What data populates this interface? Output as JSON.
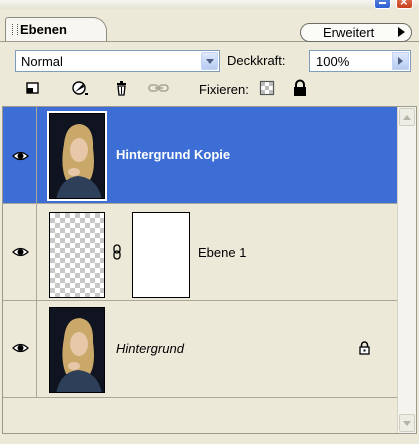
{
  "panel": {
    "tab_label": "Ebenen",
    "menu_button_label": "Erweitert"
  },
  "blend": {
    "mode": "Normal",
    "opacity_label": "Deckkraft:",
    "opacity_value": "100%"
  },
  "tools": {
    "fix_label": "Fixieren:",
    "icons": [
      "lock-transparency-icon",
      "brush-icon",
      "trash-icon",
      "link-icon",
      "lock-pixels-icon",
      "lock-all-icon"
    ]
  },
  "layers": [
    {
      "name": "Hintergrund Kopie",
      "visible": true,
      "selected": true,
      "thumbnail": "photo",
      "style": "bold"
    },
    {
      "name": "Ebene 1",
      "visible": true,
      "selected": false,
      "thumbnail": "transparent",
      "has_mask": true,
      "style": "normal"
    },
    {
      "name": "Hintergrund",
      "visible": true,
      "selected": false,
      "thumbnail": "photo",
      "locked": true,
      "style": "italic"
    }
  ],
  "colors": {
    "selection": "#3c6ed5",
    "panel_bg": "#ece9d8"
  }
}
